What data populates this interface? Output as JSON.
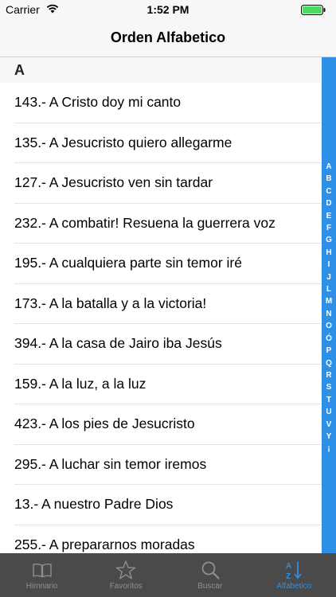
{
  "status": {
    "carrier": "Carrier",
    "time": "1:52 PM"
  },
  "nav": {
    "title": "Orden Alfabetico"
  },
  "section": {
    "letter": "A"
  },
  "rows": [
    "143.- A Cristo doy mi canto",
    "135.- A Jesucristo quiero allegarme",
    "127.- A Jesucristo ven sin tardar",
    "232.- A combatir! Resuena la guerrera voz",
    "195.- A cualquiera parte sin temor iré",
    "173.- A la batalla y a la victoria!",
    "394.- A la casa de Jairo iba Jesús",
    "159.- A la luz, a la luz",
    "423.- A los pies de Jesucristo",
    "295.- A luchar sin temor iremos",
    "13.- A nuestro Padre Dios",
    "255.- A prepararnos moradas"
  ],
  "index": [
    "A",
    "B",
    "C",
    "D",
    "E",
    "F",
    "G",
    "H",
    "I",
    "J",
    "L",
    "M",
    "N",
    "O",
    "Ó",
    "P",
    "Q",
    "R",
    "S",
    "T",
    "U",
    "V",
    "Y",
    "¡"
  ],
  "tabs": {
    "hymnal": "Himnario",
    "favorites": "Favoritos",
    "search": "Buscar",
    "alphabetic": "Alfabetico"
  },
  "icons": {
    "wifi": "wifi-icon",
    "battery": "battery-icon",
    "hymnal": "book-icon",
    "favorites": "star-icon",
    "search": "search-icon",
    "alphabetic": "sort-alpha-icon"
  },
  "colors": {
    "accent": "#2d8fe6",
    "tab_bar": "#4a4a4a",
    "battery": "#4cd964"
  }
}
